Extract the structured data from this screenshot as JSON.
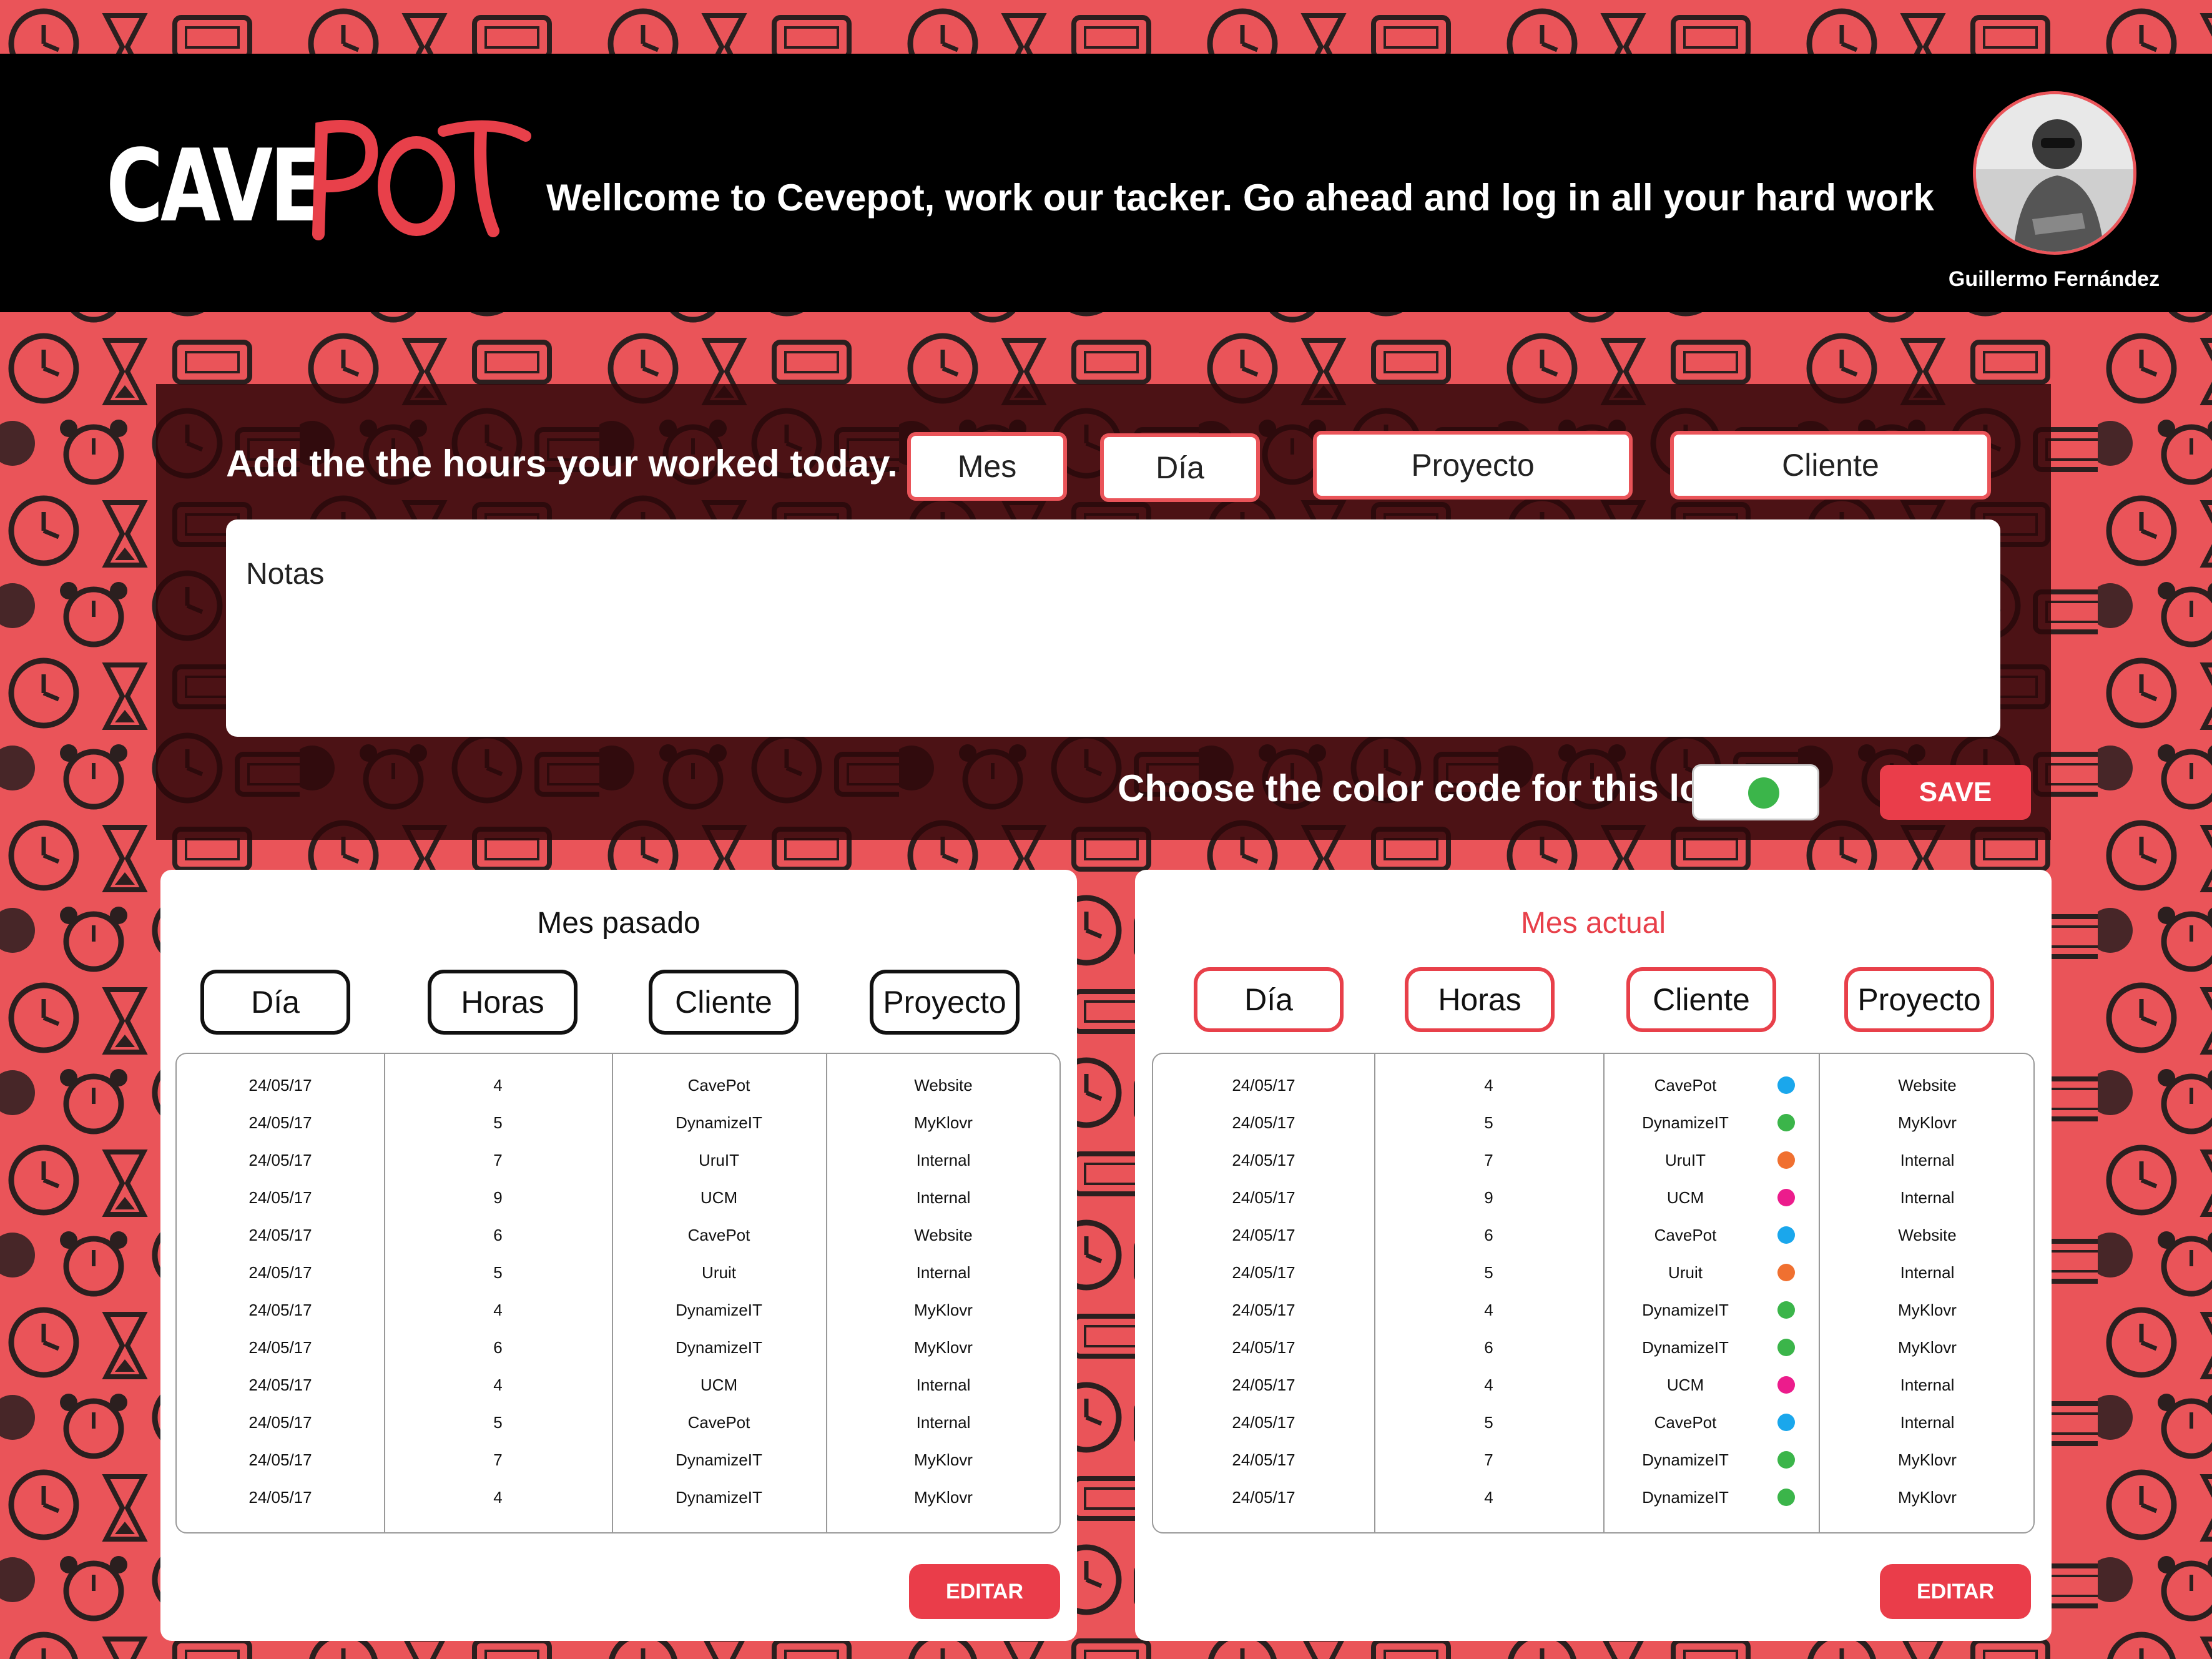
{
  "header": {
    "logo": "CAVEPOT",
    "welcome": "Wellcome to Cevepot,  work our tacker.  Go ahead and log in all your hard work",
    "user_name": "Guillermo Fernández"
  },
  "log_form": {
    "title": "Add the the hours your worked today.",
    "mes_label": "Mes",
    "dia_label": "Día",
    "proyecto_label": "Proyecto",
    "cliente_label": "Cliente",
    "notes_placeholder": "Notas",
    "color_label": "Choose the color code for this log.",
    "color_selected": "#3bb54a",
    "save_label": "SAVE"
  },
  "previous_month": {
    "title": "Mes pasado",
    "columns": [
      "Día",
      "Horas",
      "Cliente",
      "Proyecto"
    ],
    "rows": [
      [
        "24/05/17",
        "4",
        "CavePot",
        "Website"
      ],
      [
        "24/05/17",
        "5",
        "DynamizeIT",
        "MyKlovr"
      ],
      [
        "24/05/17",
        "7",
        "UruIT",
        "Internal"
      ],
      [
        "24/05/17",
        "9",
        "UCM",
        "Internal"
      ],
      [
        "24/05/17",
        "6",
        "CavePot",
        "Website"
      ],
      [
        "24/05/17",
        "5",
        "Uruit",
        "Internal"
      ],
      [
        "24/05/17",
        "4",
        "DynamizeIT",
        "MyKlovr"
      ],
      [
        "24/05/17",
        "6",
        "DynamizeIT",
        "MyKlovr"
      ],
      [
        "24/05/17",
        "4",
        "UCM",
        "Internal"
      ],
      [
        "24/05/17",
        "5",
        "CavePot",
        "Internal"
      ],
      [
        "24/05/17",
        "7",
        "DynamizeIT",
        "MyKlovr"
      ],
      [
        "24/05/17",
        "4",
        "DynamizeIT",
        "MyKlovr"
      ]
    ],
    "edit_label": "EDITAR"
  },
  "current_month": {
    "title": "Mes actual",
    "columns": [
      "Día",
      "Horas",
      "Cliente",
      "Proyecto"
    ],
    "rows": [
      [
        "24/05/17",
        "4",
        "CavePot",
        "Website",
        "#1aa7ec"
      ],
      [
        "24/05/17",
        "5",
        "DynamizeIT",
        "MyKlovr",
        "#3bb54a"
      ],
      [
        "24/05/17",
        "7",
        "UruIT",
        "Internal",
        "#f07030"
      ],
      [
        "24/05/17",
        "9",
        "UCM",
        "Internal",
        "#ec1c8c"
      ],
      [
        "24/05/17",
        "6",
        "CavePot",
        "Website",
        "#1aa7ec"
      ],
      [
        "24/05/17",
        "5",
        "Uruit",
        "Internal",
        "#f07030"
      ],
      [
        "24/05/17",
        "4",
        "DynamizeIT",
        "MyKlovr",
        "#3bb54a"
      ],
      [
        "24/05/17",
        "6",
        "DynamizeIT",
        "MyKlovr",
        "#3bb54a"
      ],
      [
        "24/05/17",
        "4",
        "UCM",
        "Internal",
        "#ec1c8c"
      ],
      [
        "24/05/17",
        "5",
        "CavePot",
        "Internal",
        "#1aa7ec"
      ],
      [
        "24/05/17",
        "7",
        "DynamizeIT",
        "MyKlovr",
        "#3bb54a"
      ],
      [
        "24/05/17",
        "4",
        "DynamizeIT",
        "MyKlovr",
        "#3bb54a"
      ]
    ],
    "edit_label": "EDITAR"
  },
  "theme": {
    "background": "#ea5459",
    "accent": "#ea3d4a",
    "header": "#000000"
  }
}
